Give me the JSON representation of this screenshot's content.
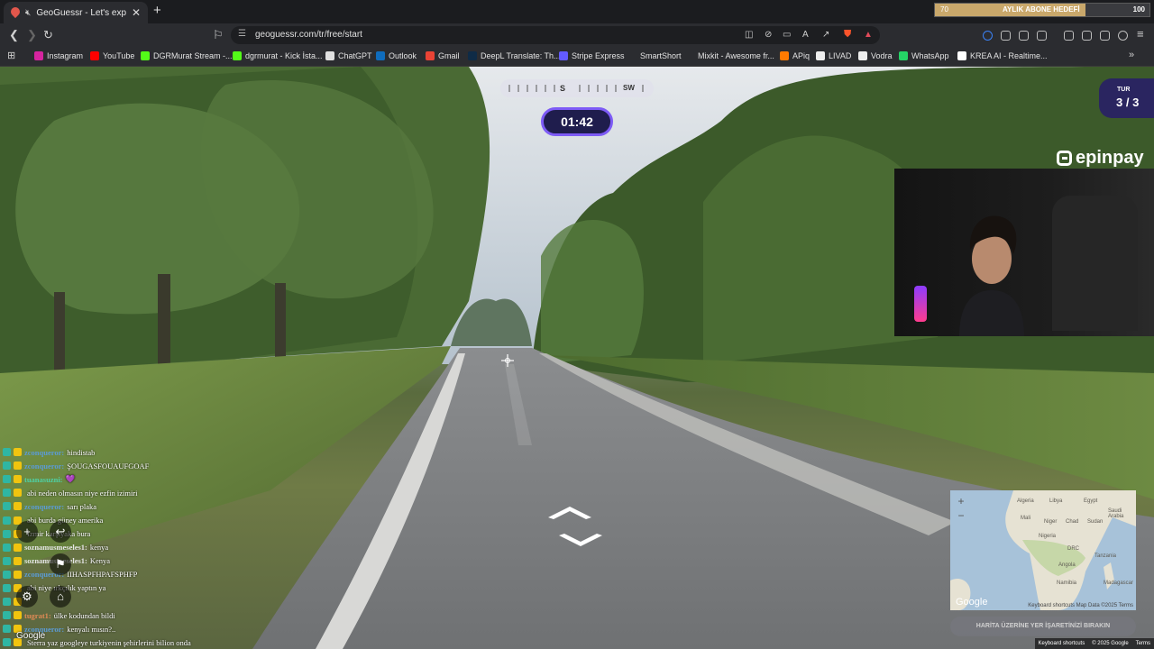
{
  "browser": {
    "tab": {
      "title": "GeoGuessr - Let's explore the",
      "close": "✕"
    },
    "new_tab": "+",
    "goal_bar": {
      "left": "70",
      "title": "AYLIK ABONE HEDEFİ",
      "right": "100",
      "progress": 0.7
    },
    "url": "geoguessr.com/tr/free/start",
    "bookmarks": [
      {
        "label": "Instagram",
        "color": "#d6249f"
      },
      {
        "label": "YouTube",
        "color": "#ff0000"
      },
      {
        "label": "DGRMurat Stream -...",
        "color": "#53fc18"
      },
      {
        "label": "dgrmurat - Kick İsta...",
        "color": "#53fc18"
      },
      {
        "label": "ChatGPT",
        "color": "#e0e0e0"
      },
      {
        "label": "Outlook",
        "color": "#0f6cbd"
      },
      {
        "label": "Gmail",
        "color": "#ea4335"
      },
      {
        "label": "DeepL Translate: Th...",
        "color": "#0f2b46"
      },
      {
        "label": "Stripe Express",
        "color": "#635bff"
      },
      {
        "label": "SmartShort",
        "color": "#2b2c30"
      },
      {
        "label": "Mixkit - Awesome fr...",
        "color": "#2b2c30"
      },
      {
        "label": "APiq",
        "color": "#ff7a00"
      },
      {
        "label": "LIVAD",
        "color": "#eeeeee"
      },
      {
        "label": "Vodra",
        "color": "#eeeeee"
      },
      {
        "label": "WhatsApp",
        "color": "#25d366"
      },
      {
        "label": "KREA AI - Realtime...",
        "color": "#ffffff"
      }
    ]
  },
  "game": {
    "compass": {
      "s": "S",
      "sw": "SW"
    },
    "timer": "01:42",
    "round": {
      "label": "TUR",
      "value": "3 / 3"
    },
    "sponsor": "epinpay",
    "guess_button": "HARİTA ÜZERİNE YER İŞARETİNİZİ BIRAKIN",
    "minimap": {
      "google": "Google",
      "footer": "Keyboard shortcuts   Map Data ©2025   Terms",
      "labels": [
        "Algeria",
        "Libya",
        "Egypt",
        "Mali",
        "Niger",
        "Chad",
        "Sudan",
        "Nigeria",
        "DRC",
        "Tanzania",
        "Angola",
        "Namibia",
        "Madagascar",
        "Saudi Arabia"
      ]
    },
    "streetview_google": "Google",
    "credits": {
      "keyboard": "Keyboard shortcuts",
      "copyright": "© 2025 Google",
      "terms": "Terms"
    }
  },
  "chat": [
    {
      "user": "zconqueror:",
      "text": "hindistab",
      "color": "#5b9bd5"
    },
    {
      "user": "zconqueror:",
      "text": "ŞOUGASFOUAUFGOAF",
      "color": "#5b9bd5"
    },
    {
      "user": "tuanasuzni:",
      "text": "💜",
      "color": "#4fd1a5"
    },
    {
      "user": "",
      "text": "abi neden olmasın niye ezfin izimiri",
      "color": "#e05555"
    },
    {
      "user": "zconqueror:",
      "text": "sarı plaka",
      "color": "#5b9bd5"
    },
    {
      "user": "",
      "text": "abi burda güney amerika",
      "color": "#e05555"
    },
    {
      "user": "",
      "text": "İzmir karşıyaka bura",
      "color": "#e05555"
    },
    {
      "user": "soznamusmeseles1:",
      "text": "kenya",
      "color": "#e5e5e5"
    },
    {
      "user": "soznamusmeseles1:",
      "text": "Kenya",
      "color": "#e5e5e5"
    },
    {
      "user": "zconqueror:",
      "text": "IIHASPFHPAFSPHFP",
      "color": "#5b9bd5"
    },
    {
      "user": "",
      "text": "abi niye ırkçılık yaptın ya",
      "color": "#e05555"
    },
    {
      "user": "",
      "text": "",
      "color": "#e05555"
    },
    {
      "user": "tugrat1:",
      "text": "ülke kodundan bildi",
      "color": "#e08a55"
    },
    {
      "user": "zconqueror:",
      "text": "kenyalı mısın?..",
      "color": "#5b9bd5"
    },
    {
      "user": "",
      "text": "Sterra yaz googleye turkiyenin şehirlerini bilion onda",
      "color": "#d970d9"
    }
  ]
}
